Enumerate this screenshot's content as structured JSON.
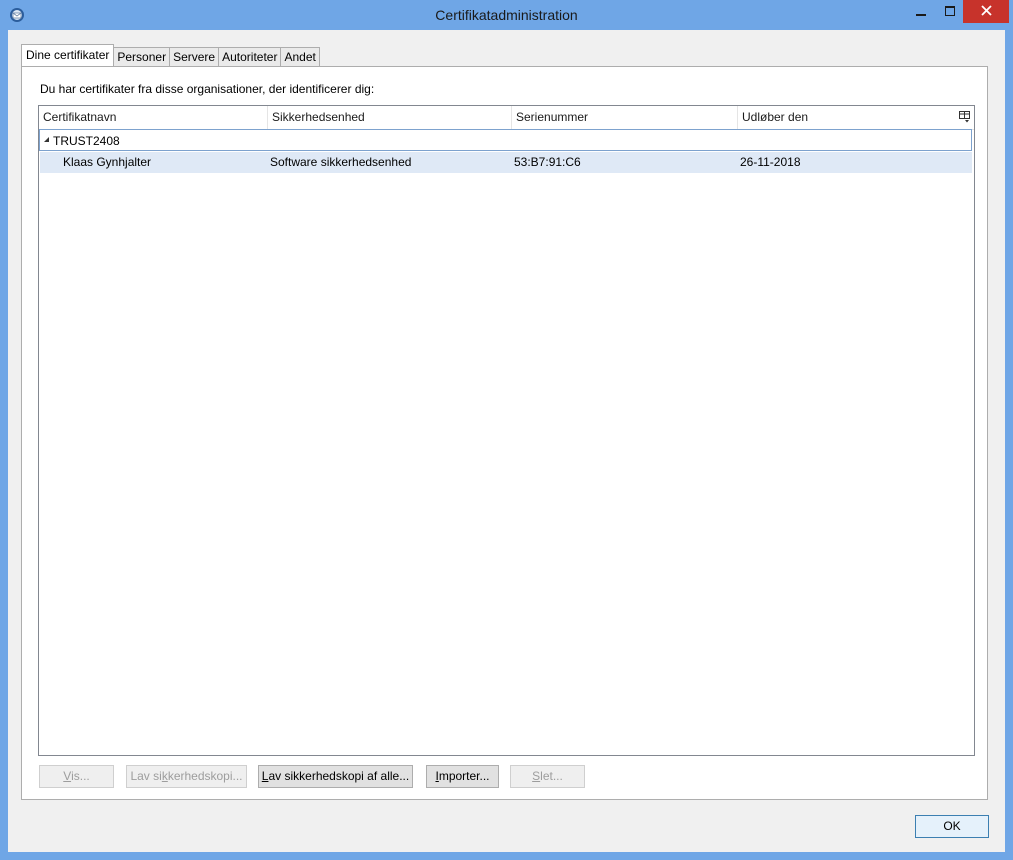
{
  "window": {
    "title": "Certifikatadministration",
    "accent": "#6fa6e6",
    "close_color": "#c7332b"
  },
  "tabs": [
    {
      "label": "Dine certifikater",
      "active": true
    },
    {
      "label": "Personer",
      "active": false
    },
    {
      "label": "Servere",
      "active": false
    },
    {
      "label": "Autoriteter",
      "active": false
    },
    {
      "label": "Andet",
      "active": false
    }
  ],
  "panel": {
    "caption": "Du har certifikater fra disse organisationer, der identificerer dig:",
    "columns": [
      "Certifikatnavn",
      "Sikkerhedsenhed",
      "Serienummer",
      "Udløber den"
    ],
    "groups": [
      {
        "name": "TRUST2408",
        "expanded": true,
        "rows": [
          {
            "name": "Klaas Gynhjalter",
            "device": "Software sikkerhedsenhed",
            "serial": "53:B7:91:C6",
            "expires": "26-11-2018",
            "selected": true
          }
        ]
      }
    ]
  },
  "buttons": {
    "view": {
      "label": "Vis...",
      "mnemonic": "V",
      "rest": "is...",
      "enabled": false
    },
    "backup": {
      "label": "Lav sikkerhedskopi...",
      "pre": "Lav si",
      "mnemonic": "k",
      "rest": "kerhedskopi...",
      "enabled": false
    },
    "backup_all": {
      "label": "Lav sikkerhedskopi af alle...",
      "mnemonic": "L",
      "rest": "av sikkerhedskopi af alle...",
      "enabled": true
    },
    "import": {
      "label": "Importer...",
      "mnemonic": "I",
      "rest": "mporter...",
      "enabled": true
    },
    "delete": {
      "label": "Slet...",
      "mnemonic": "S",
      "rest": "let...",
      "enabled": false
    },
    "ok": {
      "label": "OK",
      "enabled": true
    }
  }
}
